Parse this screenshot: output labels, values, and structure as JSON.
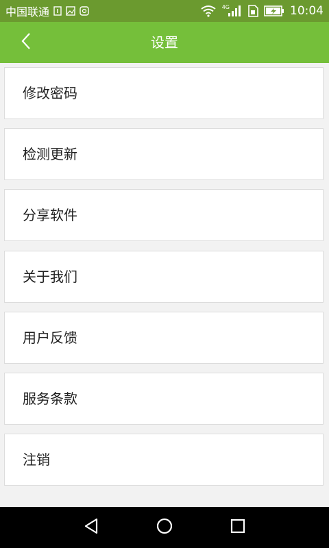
{
  "status_bar": {
    "carrier": "中国联通",
    "network_type": "4G",
    "time": "10:04",
    "icons": [
      "sim-icon",
      "image-icon",
      "notification-icon",
      "wifi-icon",
      "signal-icon",
      "sim-card-icon",
      "battery-charging-icon"
    ]
  },
  "header": {
    "title": "设置",
    "back_icon": "chevron-left-icon",
    "background_color": "#75bf3a"
  },
  "menu": {
    "items": [
      {
        "label": "修改密码"
      },
      {
        "label": "检测更新"
      },
      {
        "label": "分享软件"
      },
      {
        "label": "关于我们"
      },
      {
        "label": "用户反馈"
      },
      {
        "label": "服务条款"
      },
      {
        "label": "注销"
      }
    ]
  },
  "nav_bar": {
    "icons": [
      "back-triangle-icon",
      "home-circle-icon",
      "recents-square-icon"
    ]
  }
}
